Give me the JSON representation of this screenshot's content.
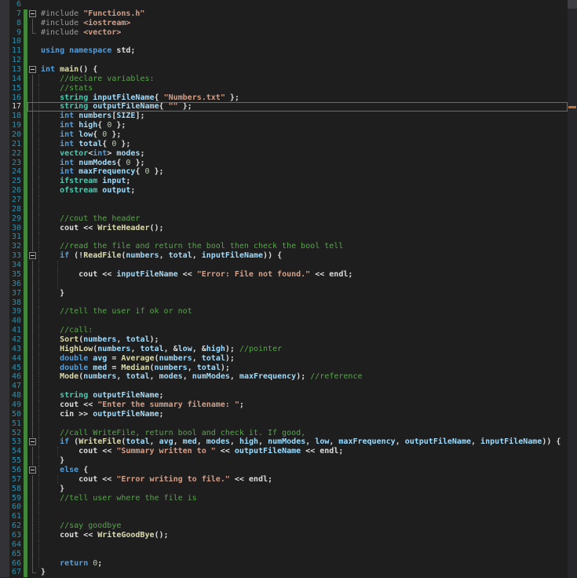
{
  "editor": {
    "colors": {
      "bg": "#1E1E1E",
      "margin_bg": "#333337",
      "ln_color": "#2B91AF",
      "change_bar": "#43873B",
      "cur_border": "#6B6B6B",
      "guide": "#3F3F46",
      "fold_line": "#565656",
      "scrollbar_mark": "#C8702E",
      "kw": "#569CD6",
      "ty": "#4EC9B0",
      "vr": "#9CDCFE",
      "fn": "#DCDCAA",
      "st": "#D69D85",
      "cm": "#57A64A",
      "nu": "#B5CEA8",
      "pp": "#9B9B9B",
      "pl": "#DCDCDC"
    },
    "first_line": 6,
    "last_line": 67,
    "current_line": 17,
    "change_bar": [
      7,
      67
    ],
    "fold": {
      "boxes": [
        7,
        13,
        33,
        53,
        56
      ],
      "ends": [
        9,
        67
      ],
      "lines": [
        [
          8,
          8
        ],
        [
          14,
          66
        ]
      ]
    },
    "indent_guides": {
      "level1": [
        [
          14,
          66
        ]
      ],
      "level2": [
        [
          34,
          36
        ],
        [
          54,
          54
        ],
        [
          57,
          57
        ]
      ]
    },
    "lines": [
      {
        "n": 6,
        "t": []
      },
      {
        "n": 7,
        "t": [
          [
            "pp",
            "#include "
          ],
          [
            "st",
            "\"Functions.h\""
          ]
        ]
      },
      {
        "n": 8,
        "t": [
          [
            "pp",
            "#include "
          ],
          [
            "st",
            "<iostream>"
          ]
        ]
      },
      {
        "n": 9,
        "t": [
          [
            "pp",
            "#include "
          ],
          [
            "st",
            "<vector>"
          ]
        ]
      },
      {
        "n": 10,
        "t": []
      },
      {
        "n": 11,
        "t": [
          [
            "kw",
            "using namespace"
          ],
          [
            "pl",
            " std;"
          ]
        ]
      },
      {
        "n": 12,
        "t": []
      },
      {
        "n": 13,
        "t": [
          [
            "kw",
            "int"
          ],
          [
            "pl",
            " "
          ],
          [
            "fn",
            "main"
          ],
          [
            "pl",
            "() {"
          ]
        ]
      },
      {
        "n": 14,
        "t": [
          [
            "pl",
            "    "
          ],
          [
            "cm",
            "//declare variables:"
          ]
        ]
      },
      {
        "n": 15,
        "t": [
          [
            "pl",
            "    "
          ],
          [
            "cm",
            "//stats"
          ]
        ]
      },
      {
        "n": 16,
        "t": [
          [
            "pl",
            "    "
          ],
          [
            "ty",
            "string"
          ],
          [
            "pl",
            " "
          ],
          [
            "vr",
            "inputFileName"
          ],
          [
            "pl",
            "{ "
          ],
          [
            "st",
            "\"Numbers.txt\""
          ],
          [
            "pl",
            " };"
          ]
        ]
      },
      {
        "n": 17,
        "t": [
          [
            "pl",
            "    "
          ],
          [
            "ty",
            "string"
          ],
          [
            "pl",
            " "
          ],
          [
            "vr",
            "outputFileName"
          ],
          [
            "pl",
            "{ "
          ],
          [
            "st",
            "\"\""
          ],
          [
            "pl",
            " };"
          ]
        ]
      },
      {
        "n": 18,
        "t": [
          [
            "pl",
            "    "
          ],
          [
            "kw",
            "int"
          ],
          [
            "pl",
            " "
          ],
          [
            "vr",
            "numbers"
          ],
          [
            "pl",
            "["
          ],
          [
            "vr",
            "SIZE"
          ],
          [
            "pl",
            "];"
          ]
        ]
      },
      {
        "n": 19,
        "t": [
          [
            "pl",
            "    "
          ],
          [
            "kw",
            "int"
          ],
          [
            "pl",
            " "
          ],
          [
            "vr",
            "high"
          ],
          [
            "pl",
            "{ "
          ],
          [
            "nu",
            "0"
          ],
          [
            "pl",
            " };"
          ]
        ]
      },
      {
        "n": 20,
        "t": [
          [
            "pl",
            "    "
          ],
          [
            "kw",
            "int"
          ],
          [
            "pl",
            " "
          ],
          [
            "vr",
            "low"
          ],
          [
            "pl",
            "{ "
          ],
          [
            "nu",
            "0"
          ],
          [
            "pl",
            " };"
          ]
        ]
      },
      {
        "n": 21,
        "t": [
          [
            "pl",
            "    "
          ],
          [
            "kw",
            "int"
          ],
          [
            "pl",
            " "
          ],
          [
            "vr",
            "total"
          ],
          [
            "pl",
            "{ "
          ],
          [
            "nu",
            "0"
          ],
          [
            "pl",
            " };"
          ]
        ]
      },
      {
        "n": 22,
        "t": [
          [
            "pl",
            "    "
          ],
          [
            "ty",
            "vector"
          ],
          [
            "pl",
            "<"
          ],
          [
            "kw",
            "int"
          ],
          [
            "pl",
            "> "
          ],
          [
            "vr",
            "modes"
          ],
          [
            "pl",
            ";"
          ]
        ]
      },
      {
        "n": 23,
        "t": [
          [
            "pl",
            "    "
          ],
          [
            "kw",
            "int"
          ],
          [
            "pl",
            " "
          ],
          [
            "vr",
            "numModes"
          ],
          [
            "pl",
            "{ "
          ],
          [
            "nu",
            "0"
          ],
          [
            "pl",
            " };"
          ]
        ]
      },
      {
        "n": 24,
        "t": [
          [
            "pl",
            "    "
          ],
          [
            "kw",
            "int"
          ],
          [
            "pl",
            " "
          ],
          [
            "vr",
            "maxFrequency"
          ],
          [
            "pl",
            "{ "
          ],
          [
            "nu",
            "0"
          ],
          [
            "pl",
            " };"
          ]
        ]
      },
      {
        "n": 25,
        "t": [
          [
            "pl",
            "    "
          ],
          [
            "ty",
            "ifstream"
          ],
          [
            "pl",
            " "
          ],
          [
            "vr",
            "input"
          ],
          [
            "pl",
            ";"
          ]
        ]
      },
      {
        "n": 26,
        "t": [
          [
            "pl",
            "    "
          ],
          [
            "ty",
            "ofstream"
          ],
          [
            "pl",
            " "
          ],
          [
            "vr",
            "output"
          ],
          [
            "pl",
            ";"
          ]
        ]
      },
      {
        "n": 27,
        "t": []
      },
      {
        "n": 28,
        "t": []
      },
      {
        "n": 29,
        "t": [
          [
            "pl",
            "    "
          ],
          [
            "cm",
            "//cout the header"
          ]
        ]
      },
      {
        "n": 30,
        "t": [
          [
            "pl",
            "    cout << "
          ],
          [
            "fn",
            "WriteHeader"
          ],
          [
            "pl",
            "();"
          ]
        ]
      },
      {
        "n": 31,
        "t": []
      },
      {
        "n": 32,
        "t": [
          [
            "pl",
            "    "
          ],
          [
            "cm",
            "//read the file and return the bool then check the bool tell"
          ]
        ]
      },
      {
        "n": 33,
        "t": [
          [
            "pl",
            "    "
          ],
          [
            "kw",
            "if"
          ],
          [
            "pl",
            " (!"
          ],
          [
            "fn",
            "ReadFile"
          ],
          [
            "pl",
            "("
          ],
          [
            "vr",
            "numbers"
          ],
          [
            "pl",
            ", "
          ],
          [
            "vr",
            "total"
          ],
          [
            "pl",
            ", "
          ],
          [
            "vr",
            "inputFileName"
          ],
          [
            "pl",
            ")) {"
          ]
        ]
      },
      {
        "n": 34,
        "t": []
      },
      {
        "n": 35,
        "t": [
          [
            "pl",
            "        cout << "
          ],
          [
            "vr",
            "inputFileName"
          ],
          [
            "pl",
            " << "
          ],
          [
            "st",
            "\"Error: File not found.\""
          ],
          [
            "pl",
            " << endl;"
          ]
        ]
      },
      {
        "n": 36,
        "t": []
      },
      {
        "n": 37,
        "t": [
          [
            "pl",
            "    }"
          ]
        ]
      },
      {
        "n": 38,
        "t": []
      },
      {
        "n": 39,
        "t": [
          [
            "pl",
            "    "
          ],
          [
            "cm",
            "//tell the user if ok or not"
          ]
        ]
      },
      {
        "n": 40,
        "t": []
      },
      {
        "n": 41,
        "t": [
          [
            "pl",
            "    "
          ],
          [
            "cm",
            "//call:"
          ]
        ]
      },
      {
        "n": 42,
        "t": [
          [
            "pl",
            "    "
          ],
          [
            "fn",
            "Sort"
          ],
          [
            "pl",
            "("
          ],
          [
            "vr",
            "numbers"
          ],
          [
            "pl",
            ", "
          ],
          [
            "vr",
            "total"
          ],
          [
            "pl",
            ");"
          ]
        ]
      },
      {
        "n": 43,
        "t": [
          [
            "pl",
            "    "
          ],
          [
            "fn",
            "HighLow"
          ],
          [
            "pl",
            "("
          ],
          [
            "vr",
            "numbers"
          ],
          [
            "pl",
            ", "
          ],
          [
            "vr",
            "total"
          ],
          [
            "pl",
            ", &"
          ],
          [
            "vr",
            "low"
          ],
          [
            "pl",
            ", &"
          ],
          [
            "vr",
            "high"
          ],
          [
            "pl",
            "); "
          ],
          [
            "cm",
            "//pointer"
          ]
        ]
      },
      {
        "n": 44,
        "t": [
          [
            "pl",
            "    "
          ],
          [
            "kw",
            "double"
          ],
          [
            "pl",
            " "
          ],
          [
            "vr",
            "avg"
          ],
          [
            "pl",
            " = "
          ],
          [
            "fn",
            "Average"
          ],
          [
            "pl",
            "("
          ],
          [
            "vr",
            "numbers"
          ],
          [
            "pl",
            ", "
          ],
          [
            "vr",
            "total"
          ],
          [
            "pl",
            ");"
          ]
        ]
      },
      {
        "n": 45,
        "t": [
          [
            "pl",
            "    "
          ],
          [
            "kw",
            "double"
          ],
          [
            "pl",
            " "
          ],
          [
            "vr",
            "med"
          ],
          [
            "pl",
            " = "
          ],
          [
            "fn",
            "Median"
          ],
          [
            "pl",
            "("
          ],
          [
            "vr",
            "numbers"
          ],
          [
            "pl",
            ", "
          ],
          [
            "vr",
            "total"
          ],
          [
            "pl",
            ");"
          ]
        ]
      },
      {
        "n": 46,
        "t": [
          [
            "pl",
            "    "
          ],
          [
            "fn",
            "Mode"
          ],
          [
            "pl",
            "("
          ],
          [
            "vr",
            "numbers"
          ],
          [
            "pl",
            ", "
          ],
          [
            "vr",
            "total"
          ],
          [
            "pl",
            ", "
          ],
          [
            "vr",
            "modes"
          ],
          [
            "pl",
            ", "
          ],
          [
            "vr",
            "numModes"
          ],
          [
            "pl",
            ", "
          ],
          [
            "vr",
            "maxFrequency"
          ],
          [
            "pl",
            "); "
          ],
          [
            "cm",
            "//reference"
          ]
        ]
      },
      {
        "n": 47,
        "t": []
      },
      {
        "n": 48,
        "t": [
          [
            "pl",
            "    "
          ],
          [
            "ty",
            "string"
          ],
          [
            "pl",
            " "
          ],
          [
            "vr",
            "outputFileName"
          ],
          [
            "pl",
            ";"
          ]
        ]
      },
      {
        "n": 49,
        "t": [
          [
            "pl",
            "    cout << "
          ],
          [
            "st",
            "\"Enter the summary filename: \""
          ],
          [
            "pl",
            ";"
          ]
        ]
      },
      {
        "n": 50,
        "t": [
          [
            "pl",
            "    cin >> "
          ],
          [
            "vr",
            "outputFileName"
          ],
          [
            "pl",
            ";"
          ]
        ]
      },
      {
        "n": 51,
        "t": []
      },
      {
        "n": 52,
        "t": [
          [
            "pl",
            "    "
          ],
          [
            "cm",
            "//call WriteFile, return bool and check it. If good,"
          ]
        ]
      },
      {
        "n": 53,
        "t": [
          [
            "pl",
            "    "
          ],
          [
            "kw",
            "if"
          ],
          [
            "pl",
            " ("
          ],
          [
            "fn",
            "WriteFile"
          ],
          [
            "pl",
            "("
          ],
          [
            "vr",
            "total"
          ],
          [
            "pl",
            ", "
          ],
          [
            "vr",
            "avg"
          ],
          [
            "pl",
            ", "
          ],
          [
            "vr",
            "med"
          ],
          [
            "pl",
            ", "
          ],
          [
            "vr",
            "modes"
          ],
          [
            "pl",
            ", "
          ],
          [
            "vr",
            "high"
          ],
          [
            "pl",
            ", "
          ],
          [
            "vr",
            "numModes"
          ],
          [
            "pl",
            ", "
          ],
          [
            "vr",
            "low"
          ],
          [
            "pl",
            ", "
          ],
          [
            "vr",
            "maxFrequency"
          ],
          [
            "pl",
            ", "
          ],
          [
            "vr",
            "outputFileName"
          ],
          [
            "pl",
            ", "
          ],
          [
            "vr",
            "inputFileName"
          ],
          [
            "pl",
            ")) {"
          ]
        ]
      },
      {
        "n": 54,
        "t": [
          [
            "pl",
            "        cout << "
          ],
          [
            "st",
            "\"Summary written to \""
          ],
          [
            "pl",
            " << "
          ],
          [
            "vr",
            "outputFileName"
          ],
          [
            "pl",
            " << endl;"
          ]
        ]
      },
      {
        "n": 55,
        "t": [
          [
            "pl",
            "    }"
          ]
        ]
      },
      {
        "n": 56,
        "t": [
          [
            "pl",
            "    "
          ],
          [
            "kw",
            "else"
          ],
          [
            "pl",
            " {"
          ]
        ]
      },
      {
        "n": 57,
        "t": [
          [
            "pl",
            "        cout << "
          ],
          [
            "st",
            "\"Error writing to file.\""
          ],
          [
            "pl",
            " << endl;"
          ]
        ]
      },
      {
        "n": 58,
        "t": [
          [
            "pl",
            "    }"
          ]
        ]
      },
      {
        "n": 59,
        "t": [
          [
            "pl",
            "    "
          ],
          [
            "cm",
            "//tell user where the file is"
          ]
        ]
      },
      {
        "n": 60,
        "t": []
      },
      {
        "n": 61,
        "t": []
      },
      {
        "n": 62,
        "t": [
          [
            "pl",
            "    "
          ],
          [
            "cm",
            "//say goodbye"
          ]
        ]
      },
      {
        "n": 63,
        "t": [
          [
            "pl",
            "    cout << "
          ],
          [
            "fn",
            "WriteGoodBye"
          ],
          [
            "pl",
            "();"
          ]
        ]
      },
      {
        "n": 64,
        "t": []
      },
      {
        "n": 65,
        "t": []
      },
      {
        "n": 66,
        "t": [
          [
            "pl",
            "    "
          ],
          [
            "kw",
            "return"
          ],
          [
            "pl",
            " "
          ],
          [
            "nu",
            "0"
          ],
          [
            "pl",
            ";"
          ]
        ]
      },
      {
        "n": 67,
        "t": [
          [
            "pl",
            "}"
          ]
        ]
      }
    ]
  }
}
